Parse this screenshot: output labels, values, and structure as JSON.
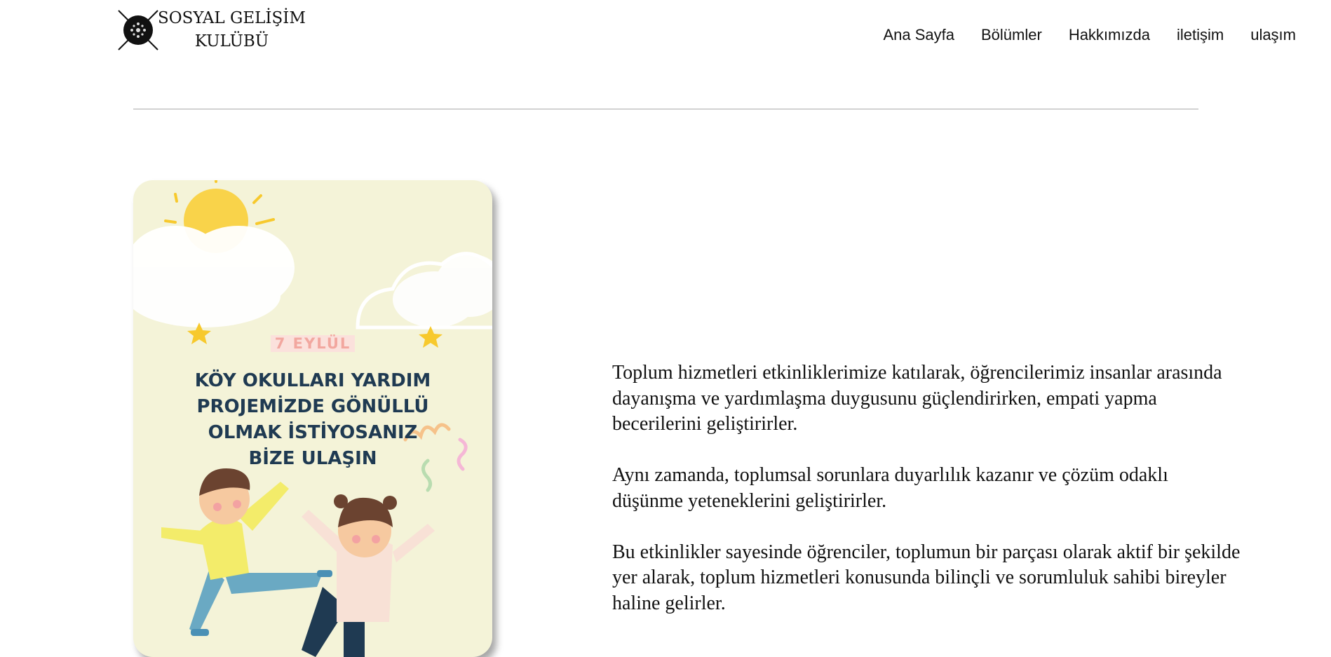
{
  "logo": {
    "line1": "SOSYAL GELİŞİM",
    "line2": "KULÜBÜ",
    "icon": "club-emblem-icon"
  },
  "nav": {
    "items": [
      {
        "label": "Ana Sayfa"
      },
      {
        "label": "Bölümler"
      },
      {
        "label": "Hakkımızda"
      },
      {
        "label": "iletişim"
      },
      {
        "label": "ulaşım"
      }
    ]
  },
  "poster": {
    "date": "7 EYLÜL",
    "title_lines": [
      "KÖY OKULLARI YARDIM",
      "PROJEMİZDE GÖNÜLLÜ",
      "OLMAK İSTİYOSANIZ",
      "BİZE ULAŞIN"
    ],
    "background_color": "#f4f3d8",
    "title_color": "#1f3a52",
    "date_color": "#f2a79f"
  },
  "content": {
    "paragraphs": [
      "Toplum hizmetleri etkinliklerimize katılarak, öğrencilerimiz insanlar arasında dayanışma ve yardımlaşma duygusunu güçlendirirken, empati yapma becerilerini geliştirirler.",
      "Aynı zamanda, toplumsal sorunlara duyarlılık kazanır ve çözüm odaklı düşünme yeteneklerini geliştirirler.",
      "Bu etkinlikler sayesinde öğrenciler, toplumun bir parçası olarak aktif bir şekilde yer alarak, toplum hizmetleri konusunda bilinçli ve sorumluluk sahibi bireyler haline gelirler."
    ]
  }
}
